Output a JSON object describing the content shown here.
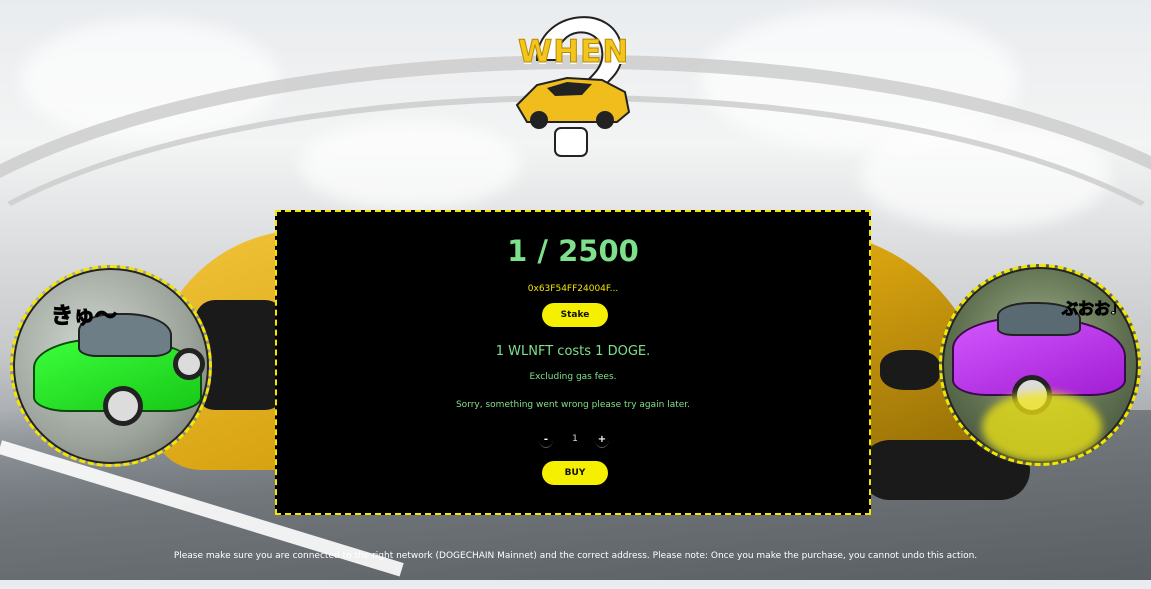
{
  "logo": {
    "text": "WHEN",
    "icon": "question-mark-car-logo"
  },
  "mint": {
    "supply": "1 / 2500",
    "address": "0x63F54FF24004F...",
    "stake_label": "Stake",
    "cost_text": "1 WLNFT costs 1 DOGE.",
    "gas_note": "Excluding gas fees.",
    "error_text": "Sorry, something went wrong please try again later.",
    "quantity": {
      "decrement_label": "-",
      "value": "1",
      "increment_label": "+"
    },
    "buy_label": "BUY"
  },
  "left_image": {
    "caption": "きゅ〜"
  },
  "right_image": {
    "caption": "ぶおお♪"
  },
  "footer": {
    "notice": "Please make sure you are connected to the right network (DOGECHAIN Mainnet) and the correct address. Please note: Once you make the purchase, you cannot undo this action."
  },
  "colors": {
    "accent_yellow": "#f5f000",
    "border_yellow": "#f5e400",
    "text_green": "#7ee08a",
    "panel_bg": "#000000"
  }
}
